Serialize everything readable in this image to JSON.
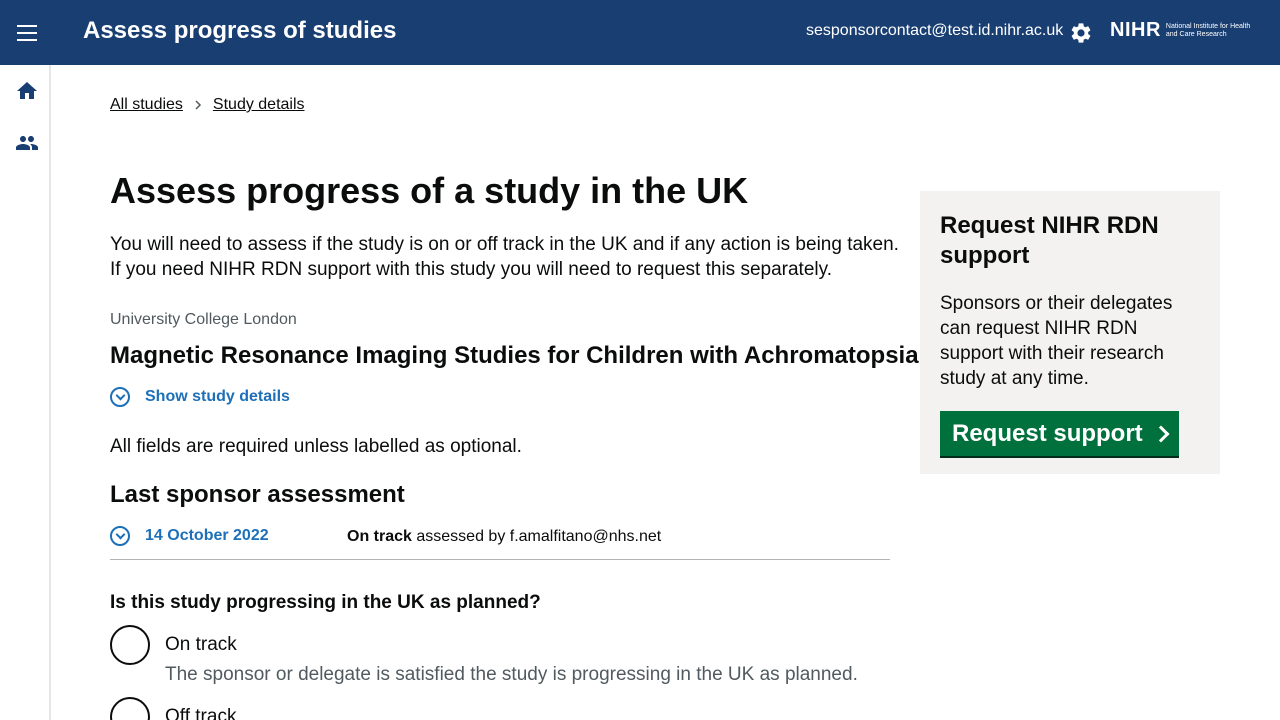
{
  "header": {
    "title": "Assess progress of studies",
    "user_email": "sesponsorcontact@test.id.nihr.ac.uk",
    "logo_text": "NIHR",
    "logo_subtitle": "National Institute for Health and Care Research"
  },
  "breadcrumbs": [
    "All studies",
    "Study details"
  ],
  "page": {
    "heading": "Assess progress of a study in the UK",
    "intro": "You will need to assess if the study is on or off track in the UK and if any action is being taken. If you need NIHR RDN support with this study you will need to request this separately.",
    "organisation": "University College London",
    "study_title": "Magnetic Resonance Imaging Studies for Children with Achromatopsia",
    "show_details_label": "Show study details",
    "required_note": "All fields are required unless labelled as optional.",
    "last_assessment_heading": "Last sponsor assessment",
    "last_assessment": {
      "date": "14 October 2022",
      "status": "On track",
      "assessed_by_text": "assessed by f.amalfitano@nhs.net"
    },
    "question": "Is this study progressing in the UK as planned?",
    "options": [
      {
        "label": "On track",
        "hint": "The sponsor or delegate is satisfied the study is progressing in the UK as planned."
      },
      {
        "label": "Off track",
        "hint": ""
      }
    ]
  },
  "panel": {
    "title": "Request NIHR RDN support",
    "text": "Sponsors or their delegates can request NIHR RDN support with their research study at any time.",
    "button_label": "Request support"
  },
  "icons": {
    "menu": "menu-icon",
    "settings": "gear-icon",
    "home": "home-icon",
    "users": "users-icon"
  },
  "colors": {
    "header_bg": "#193e72",
    "link_blue": "#1d70b8",
    "button_green": "#00703c",
    "panel_bg": "#f3f2f1"
  }
}
